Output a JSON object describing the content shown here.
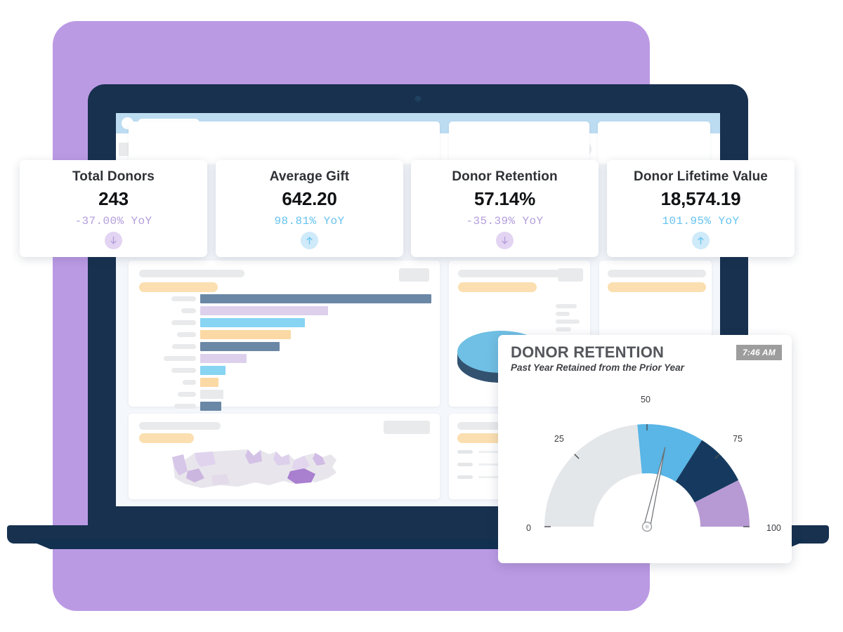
{
  "browser": {
    "tab_placeholder": "",
    "search_placeholder": "",
    "toolbar_icon_count": 9
  },
  "kpis": [
    {
      "title": "Total Donors",
      "value": "243",
      "delta": "-37.00% YoY",
      "direction": "down",
      "color": "#b39ddb",
      "badge_bg": "#e2d4f2",
      "arrow": "↓"
    },
    {
      "title": "Average Gift",
      "value": "642.20",
      "delta": "98.81% YoY",
      "direction": "up",
      "color": "#67c3ef",
      "badge_bg": "#cfeaf9",
      "arrow": "↑"
    },
    {
      "title": "Donor Retention",
      "value": "57.14%",
      "delta": "-35.39% YoY",
      "direction": "down",
      "color": "#b39ddb",
      "badge_bg": "#e2d4f2",
      "arrow": "↓"
    },
    {
      "title": "Donor Lifetime Value",
      "value": "18,574.19",
      "delta": "101.95% YoY",
      "direction": "up",
      "color": "#67c3ef",
      "badge_bg": "#cfeaf9",
      "arrow": "↑"
    }
  ],
  "gauge_card": {
    "title": "DONOR RETENTION",
    "subtitle": "Past Year Retained from the Prior Year",
    "timestamp": "7:46 AM"
  },
  "chart_data": {
    "type": "gauge",
    "title": "DONOR RETENTION",
    "subtitle": "Past Year Retained from the Prior Year",
    "value": 57.14,
    "min": 0,
    "max": 100,
    "tick_labels": [
      "0",
      "25",
      "50",
      "75",
      "100"
    ],
    "tick_values": [
      0,
      25,
      50,
      75,
      100
    ],
    "bands": [
      {
        "from": 0,
        "to": 47,
        "color": "#e4e7ea"
      },
      {
        "from": 47,
        "to": 68,
        "color": "#59b6e6"
      },
      {
        "from": 68,
        "to": 85,
        "color": "#163a5f"
      },
      {
        "from": 85,
        "to": 100,
        "color": "#b79ad3"
      }
    ],
    "needle_color": "#6b6e72",
    "grid": false,
    "legend": "none"
  },
  "background_dashboard": {
    "bar_chart": {
      "type": "bar",
      "orientation": "horizontal",
      "values": [
        100,
        55,
        45,
        39,
        34,
        20,
        11,
        8,
        10,
        9
      ],
      "colors": [
        "#6a87a5",
        "#ddd0ec",
        "#87d4f3",
        "#fbd9a4",
        "#6a87a5",
        "#ddd0ec",
        "#87d4f3",
        "#fbd9a4",
        "#e9eaec",
        "#6a87a5"
      ],
      "label_widths": [
        83,
        50,
        83,
        65,
        80,
        110,
        83,
        45,
        62,
        75
      ]
    },
    "pie_chart": {
      "type": "pie",
      "slices": [
        60,
        40
      ],
      "colors": [
        "#70bfe4",
        "#44688a"
      ]
    },
    "map": {
      "type": "choropleth",
      "region": "United States"
    },
    "table_rows": 3
  },
  "palette": {
    "purple_bg": "#bb9ae4",
    "laptop_navy": "#17314f",
    "browser_blue": "#bcdcf2",
    "card_white": "#ffffff",
    "accent_blue": "#67c3ef",
    "accent_purple": "#b39ddb"
  }
}
